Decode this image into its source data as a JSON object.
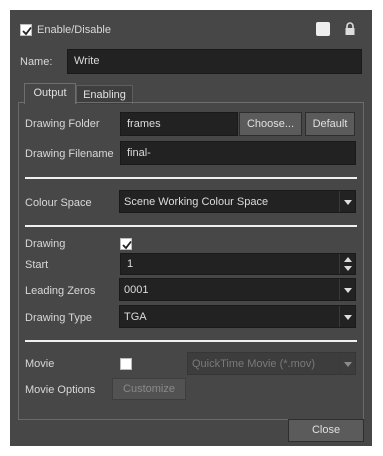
{
  "header": {
    "enable_label": "Enable/Disable",
    "enabled": true,
    "color_swatch": "#eeeeee",
    "lock_icon": "lock-icon"
  },
  "name_row": {
    "label": "Name:",
    "value": "Write"
  },
  "tabs": [
    {
      "label": "Output",
      "active": true
    },
    {
      "label": "Enabling",
      "active": false
    }
  ],
  "output": {
    "drawing_folder_label": "Drawing Folder",
    "drawing_folder_value": "frames",
    "choose_button": "Choose...",
    "default_button": "Default",
    "drawing_filename_label": "Drawing Filename",
    "drawing_filename_value": "final-",
    "colour_space_label": "Colour Space",
    "colour_space_value": "Scene Working Colour Space",
    "drawing_label": "Drawing",
    "drawing_checked": true,
    "start_label": "Start",
    "start_value": "1",
    "leading_zeros_label": "Leading Zeros",
    "leading_zeros_value": "0001",
    "drawing_type_label": "Drawing Type",
    "drawing_type_value": "TGA",
    "movie_label": "Movie",
    "movie_checked": false,
    "movie_format_value": "QuickTime Movie (*.mov)",
    "movie_options_label": "Movie Options",
    "customize_button": "Customize"
  },
  "footer": {
    "close_button": "Close"
  },
  "colors": {
    "panel_bg": "#474747",
    "field_bg": "#222222",
    "text": "#d8d8d8"
  }
}
